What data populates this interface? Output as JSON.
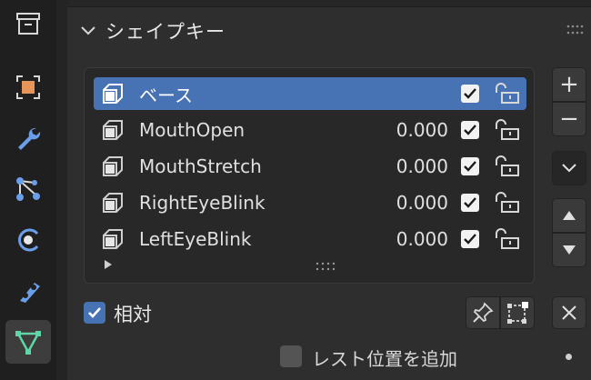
{
  "panel": {
    "title": "シェイプキー"
  },
  "tabs": [
    {
      "id": "world",
      "icon": "world-archive-icon",
      "active": false
    },
    {
      "id": "object",
      "icon": "object-icon",
      "active": false
    },
    {
      "id": "modifiers",
      "icon": "wrench-icon",
      "active": false
    },
    {
      "id": "particles",
      "icon": "particles-icon",
      "active": false
    },
    {
      "id": "physics",
      "icon": "physics-icon",
      "active": false
    },
    {
      "id": "constraints",
      "icon": "constraint-icon",
      "active": false
    },
    {
      "id": "data",
      "icon": "mesh-data-icon",
      "active": true
    }
  ],
  "shape_keys": [
    {
      "name": "ベース",
      "value": "",
      "checked": true,
      "selected": true
    },
    {
      "name": "MouthOpen",
      "value": "0.000",
      "checked": true,
      "selected": false
    },
    {
      "name": "MouthStretch",
      "value": "0.000",
      "checked": true,
      "selected": false
    },
    {
      "name": "RightEyeBlink",
      "value": "0.000",
      "checked": true,
      "selected": false
    },
    {
      "name": "LeftEyeBlink",
      "value": "0.000",
      "checked": true,
      "selected": false
    }
  ],
  "buttons": {
    "add": "+",
    "remove": "−"
  },
  "relative": {
    "label": "相対",
    "checked": true
  },
  "rest_position": {
    "label": "レスト位置を追加",
    "checked": false
  },
  "colors": {
    "accent": "#4772b3",
    "panel_bg": "#2e2e2e",
    "list_bg": "#282828",
    "tab_active_icon": "#5ed6a8"
  }
}
